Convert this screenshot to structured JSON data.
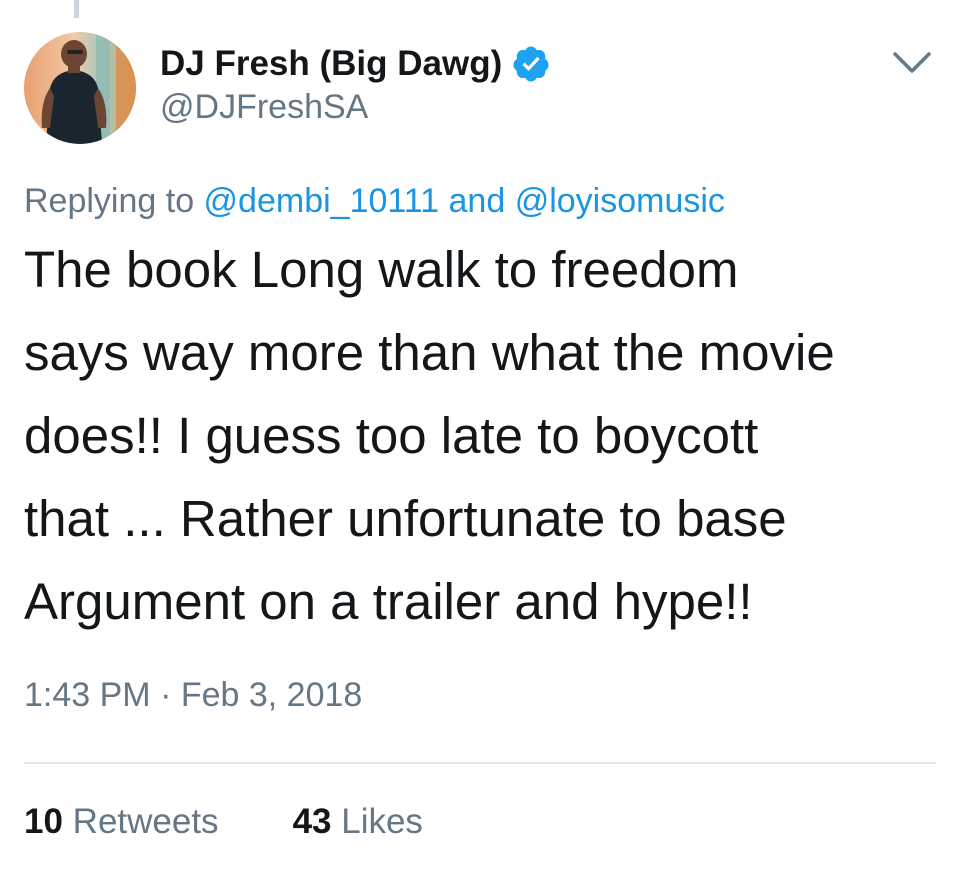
{
  "tweet": {
    "author": {
      "display_name": "DJ Fresh (Big Dawg)",
      "handle": "@DJFreshSA",
      "verified": true
    },
    "reply": {
      "prefix": "Replying to ",
      "mention_1": "@dembi_10111",
      "joiner": " and ",
      "mention_2": "@loyisomusic"
    },
    "text_lines": [
      "The book Long walk to freedom",
      "says way more than what the movie",
      "does!! I guess too late to boycott",
      "that ... Rather unfortunate to base",
      "Argument on a trailer and hype!!"
    ],
    "timestamp": "1:43 PM · Feb 3, 2018",
    "stats": {
      "retweets_count": "10",
      "retweets_label": " Retweets",
      "likes_count": "43",
      "likes_label": " Likes"
    }
  },
  "icons": {
    "verified": "verified-badge-icon",
    "menu": "chevron-down-icon"
  },
  "colors": {
    "link": "#1b95e0",
    "muted": "#657786",
    "text": "#14171a",
    "verified": "#1da1f2",
    "divider": "#e1e8ed"
  }
}
